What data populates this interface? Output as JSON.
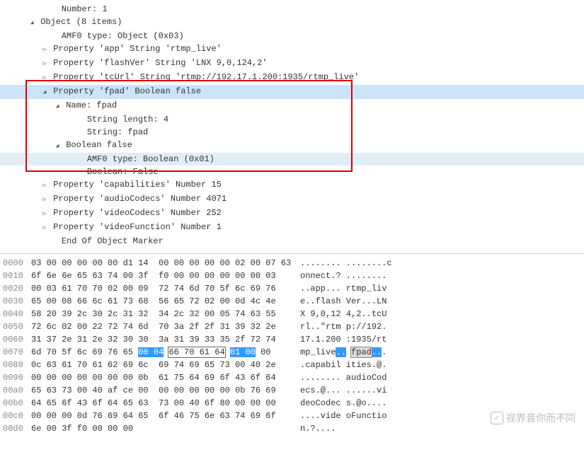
{
  "tree": {
    "number": "Number: 1",
    "object": "Object (8 items)",
    "amf0type": "AMF0 type: Object (0x03)",
    "prop_app": "Property 'app' String 'rtmp_live'",
    "prop_flashver": "Property 'flashVer' String 'LNX 9,0,124,2'",
    "prop_tcurl": "Property 'tcUrl' String 'rtmp://192.17.1.200:1935/rtmp_live'",
    "prop_fpad": "Property 'fpad' Boolean false",
    "name_fpad": "Name: fpad",
    "strlen": "String length: 4",
    "str_fpad": "String: fpad",
    "bool_false": "Boolean false",
    "amf0_bool": "AMF0 type: Boolean (0x01)",
    "bool_val": "Boolean: False",
    "prop_cap": "Property 'capabilities' Number 15",
    "prop_audio": "Property 'audioCodecs' Number 4071",
    "prop_video": "Property 'videoCodecs' Number 252",
    "prop_vfunc": "Property 'videoFunction' Number 1",
    "end_marker": "End Of Object Marker"
  },
  "hex": [
    {
      "off": "0000",
      "b1": "03 00 00 00 00 00 d1 14",
      "b2": "  00 00 00 00 00 02 00 07 63",
      "a": "........ ........c"
    },
    {
      "off": "0010",
      "b1": "6f 6e 6e 65 63 74 00 3f",
      "b2": "  f0 00 00 00 00 00 00 03    ",
      "a": "onnect.? ........"
    },
    {
      "off": "0020",
      "b1": "00 03 61 70 70 02 00 09",
      "b2": "  72 74 6d 70 5f 6c 69 76    ",
      "a": "..app... rtmp_liv"
    },
    {
      "off": "0030",
      "b1": "65 00 08 66 6c 61 73 68",
      "b2": "  56 65 72 02 00 0d 4c 4e    ",
      "a": "e..flash Ver...LN"
    },
    {
      "off": "0040",
      "b1": "58 20 39 2c 30 2c 31 32",
      "b2": "  34 2c 32 00 05 74 63 55    ",
      "a": "X 9,0,12 4,2..tcU"
    },
    {
      "off": "0050",
      "b1": "72 6c 02 00 22 72 74 6d",
      "b2": "  70 3a 2f 2f 31 39 32 2e    ",
      "a": "rl..\"rtm p://192."
    },
    {
      "off": "0060",
      "b1": "31 37 2e 31 2e 32 30 30",
      "b2": "  3a 31 39 33 35 2f 72 74    ",
      "a": "17.1.200 :1935/rt"
    },
    {
      "off": "0080",
      "b1": "0c 63 61 70 61 62 69 6c",
      "b2": "  69 74 69 65 73 00 40 2e    ",
      "a": ".capabil ities.@."
    },
    {
      "off": "0090",
      "b1": "00 00 00 00 00 00 00 0b",
      "b2": "  61 75 64 69 6f 43 6f 64    ",
      "a": "........ audioCod"
    },
    {
      "off": "00a0",
      "b1": "65 63 73 00 40 af ce 00",
      "b2": "  00 00 00 00 00 0b 76 69    ",
      "a": "ecs.@... ......vi"
    },
    {
      "off": "00b0",
      "b1": "64 65 6f 43 6f 64 65 63",
      "b2": "  73 00 40 6f 80 00 00 00    ",
      "a": "deoCodec s.@o...."
    },
    {
      "off": "00c0",
      "b1": "00 00 00 0d 76 69 64 65",
      "b2": "  6f 46 75 6e 63 74 69 6f    ",
      "a": "....vide oFunctio"
    },
    {
      "off": "00d0",
      "b1": "6e 00 3f f0 00 00 00 ",
      "b2": "                               ",
      "a": "n.?.... "
    }
  ],
  "hex_hl": {
    "off": "0070",
    "prefix": "6d 70 5f 6c 69 76 65 ",
    "hl1": "00 04",
    "hl2": "66 70 61 64",
    "hl3": "01 00",
    "suffix": "00    ",
    "ascii_prefix": "mp_live",
    "ascii_hl1": "..",
    "ascii_hl2": "fpad",
    "ascii_hl3": "..",
    "ascii_suffix": "."
  },
  "watermark": "视界音你而不同"
}
